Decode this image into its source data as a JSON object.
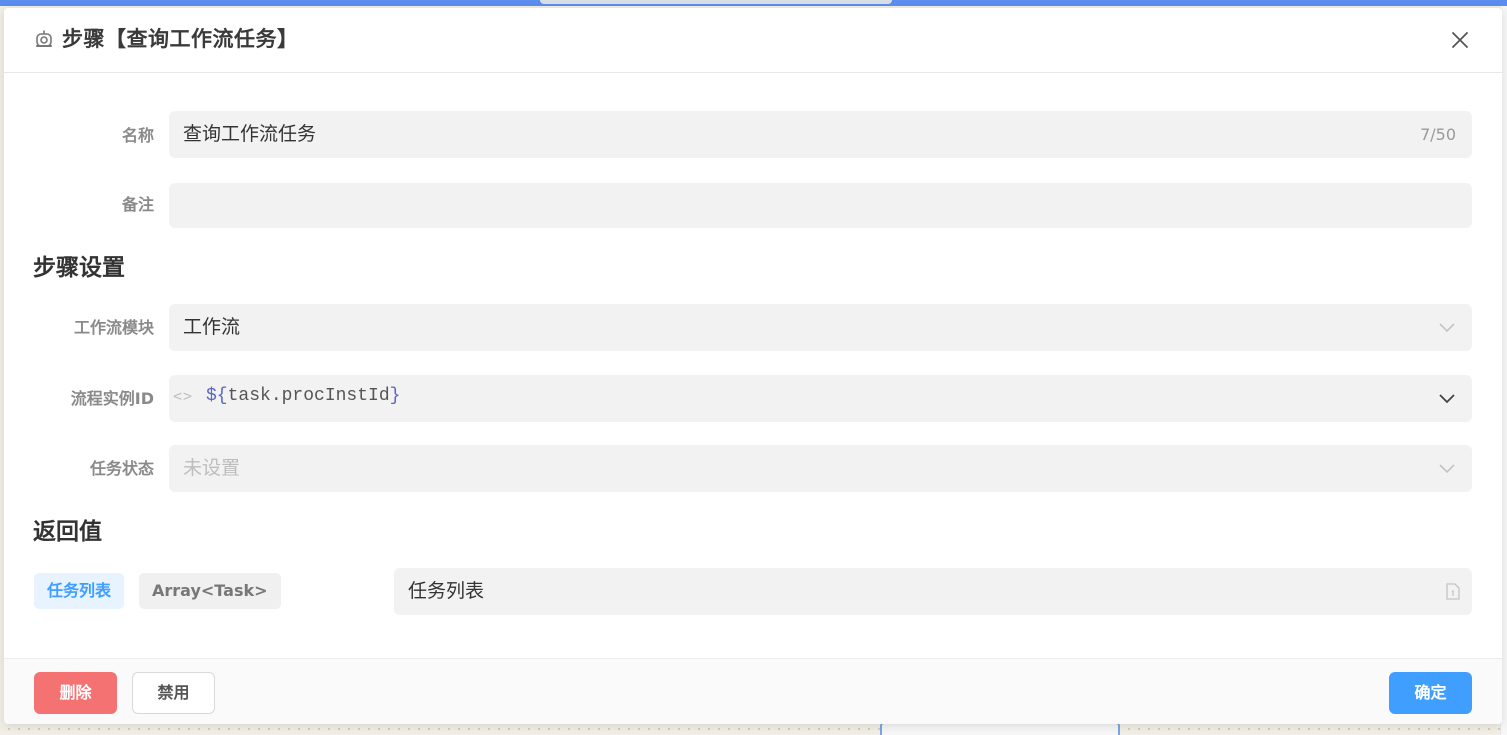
{
  "dialog": {
    "title": "步骤【查询工作流任务】",
    "icon": "robot-icon"
  },
  "basic": {
    "name_label": "名称",
    "name_value": "查询工作流任务",
    "name_counter": "7/50",
    "remark_label": "备注",
    "remark_value": ""
  },
  "step_settings": {
    "title": "步骤设置",
    "module_label": "工作流模块",
    "module_value": "工作流",
    "instance_label": "流程实例ID",
    "instance_prefix": "${",
    "instance_var": "task.procInstId",
    "instance_suffix": "}",
    "status_label": "任务状态",
    "status_placeholder": "未设置"
  },
  "return_value": {
    "title": "返回值",
    "name_tag": "任务列表",
    "type_tag": "Array<Task>",
    "alias_value": "任务列表"
  },
  "footer": {
    "delete_label": "删除",
    "disable_label": "禁用",
    "confirm_label": "确定"
  },
  "colors": {
    "primary": "#409eff",
    "danger": "#f57272",
    "topbar": "#5b8def"
  }
}
